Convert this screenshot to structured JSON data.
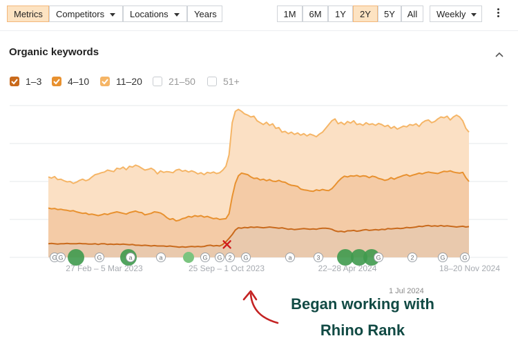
{
  "toolbar": {
    "tabs": [
      {
        "label": "Metrics",
        "active": true
      },
      {
        "label": "Competitors",
        "dropdown": true
      },
      {
        "label": "Locations",
        "dropdown": true
      },
      {
        "label": "Years"
      }
    ],
    "ranges": [
      "1M",
      "6M",
      "1Y",
      "2Y",
      "5Y",
      "All"
    ],
    "active_range": "2Y",
    "interval": "Weekly"
  },
  "section": {
    "title": "Organic keywords"
  },
  "legend": [
    {
      "label": "1–3",
      "checked": true,
      "color": "#c96a1c"
    },
    {
      "label": "4–10",
      "checked": true,
      "color": "#e8912f"
    },
    {
      "label": "11–20",
      "checked": true,
      "color": "#f5b566"
    },
    {
      "label": "21–50",
      "checked": false
    },
    {
      "label": "51+",
      "checked": false
    }
  ],
  "chart_data": {
    "type": "area",
    "stacked": true,
    "x_ticks": [
      "27 Feb – 5 Mar 2023",
      "25 Sep – 1 Oct 2023",
      "22–28 Apr 2024",
      "18–20 Nov 2024"
    ],
    "extra_date_label": "1 Jul 2024",
    "grid": true,
    "ylim": [
      0,
      4
    ],
    "series": [
      {
        "name": "1–3",
        "color": "#c96a1c",
        "fill": "#e9c9ad",
        "values": [
          0.36,
          0.37,
          0.36,
          0.35,
          0.36,
          0.36,
          0.37,
          0.36,
          0.36,
          0.36,
          0.37,
          0.36,
          0.36,
          0.35,
          0.35,
          0.36,
          0.34,
          0.36,
          0.36,
          0.34,
          0.35,
          0.34,
          0.35,
          0.34,
          0.35,
          0.34,
          0.33,
          0.34,
          0.32,
          0.32,
          0.31,
          0.32,
          0.31,
          0.3,
          0.31,
          0.3,
          0.3,
          0.3,
          0.29,
          0.3,
          0.29,
          0.28,
          0.27,
          0.28,
          0.27,
          0.28,
          0.29,
          0.28,
          0.29,
          0.28,
          0.29,
          0.31,
          0.32,
          0.3,
          0.31,
          0.3,
          0.34,
          0.41,
          0.5,
          0.6,
          0.72,
          0.78,
          0.77,
          0.79,
          0.78,
          0.8,
          0.79,
          0.8,
          0.79,
          0.78,
          0.79,
          0.8,
          0.79,
          0.78,
          0.77,
          0.78,
          0.76,
          0.74,
          0.75,
          0.73,
          0.74,
          0.75,
          0.76,
          0.75,
          0.74,
          0.75,
          0.74,
          0.76,
          0.77,
          0.77,
          0.76,
          0.74,
          0.7,
          0.68,
          0.69,
          0.67,
          0.7,
          0.7,
          0.71,
          0.69,
          0.7,
          0.72,
          0.73,
          0.71,
          0.72,
          0.73,
          0.72,
          0.74,
          0.73,
          0.76,
          0.75,
          0.76,
          0.77,
          0.76,
          0.77,
          0.79,
          0.78,
          0.79,
          0.8,
          0.82,
          0.81,
          0.83,
          0.84,
          0.82,
          0.83,
          0.82,
          0.84,
          0.82,
          0.83,
          0.82,
          0.81,
          0.8,
          0.81,
          0.82,
          0.8,
          0.81
        ]
      },
      {
        "name": "4–10",
        "color": "#e8912f",
        "fill": "#f4cba6",
        "values": [
          1.3,
          1.28,
          1.29,
          1.26,
          1.27,
          1.25,
          1.24,
          1.22,
          1.23,
          1.2,
          1.18,
          1.16,
          1.17,
          1.13,
          1.14,
          1.12,
          1.1,
          1.12,
          1.15,
          1.13,
          1.16,
          1.18,
          1.2,
          1.18,
          1.16,
          1.14,
          1.18,
          1.2,
          1.22,
          1.19,
          1.18,
          1.12,
          1.14,
          1.16,
          1.2,
          1.19,
          1.17,
          1.12,
          1.05,
          1.0,
          1.02,
          0.96,
          0.98,
          1.02,
          1.04,
          1.08,
          1.06,
          1.1,
          1.08,
          1.1,
          1.06,
          1.08,
          1.05,
          1.02,
          1.03,
          1.0,
          1.01,
          1.02,
          1.15,
          1.6,
          1.95,
          2.15,
          2.22,
          2.2,
          2.18,
          2.12,
          2.08,
          2.09,
          2.04,
          2.06,
          2.02,
          2.05,
          2.01,
          2.0,
          2.03,
          1.99,
          1.98,
          1.93,
          1.9,
          1.89,
          1.87,
          1.8,
          1.78,
          1.77,
          1.75,
          1.74,
          1.78,
          1.76,
          1.79,
          1.77,
          1.76,
          1.81,
          1.9,
          2.0,
          2.08,
          2.14,
          2.12,
          2.15,
          2.14,
          2.16,
          2.13,
          2.15,
          2.14,
          2.1,
          2.14,
          2.12,
          2.08,
          2.06,
          2.03,
          2.05,
          2.1,
          2.06,
          2.1,
          2.13,
          2.16,
          2.18,
          2.14,
          2.17,
          2.19,
          2.22,
          2.2,
          2.23,
          2.25,
          2.23,
          2.22,
          2.21,
          2.24,
          2.27,
          2.26,
          2.28,
          2.25,
          2.23,
          2.22,
          2.24,
          2.1,
          2.0
        ]
      },
      {
        "name": "11–20",
        "color": "#f5b566",
        "fill": "#fbe0c4",
        "values": [
          2.12,
          2.09,
          2.13,
          2.05,
          2.06,
          2.02,
          1.99,
          2.0,
          1.95,
          1.98,
          2.03,
          2.06,
          2.02,
          2.05,
          2.12,
          2.18,
          2.2,
          2.23,
          2.25,
          2.3,
          2.28,
          2.26,
          2.35,
          2.33,
          2.38,
          2.31,
          2.4,
          2.38,
          2.43,
          2.4,
          2.35,
          2.3,
          2.32,
          2.35,
          2.3,
          2.2,
          2.28,
          2.24,
          2.26,
          2.25,
          2.23,
          2.3,
          2.32,
          2.27,
          2.29,
          2.25,
          2.28,
          2.25,
          2.2,
          2.23,
          2.18,
          2.24,
          2.22,
          2.25,
          2.21,
          2.23,
          2.3,
          2.4,
          2.7,
          3.55,
          3.85,
          3.9,
          3.85,
          3.78,
          3.75,
          3.7,
          3.72,
          3.6,
          3.55,
          3.5,
          3.56,
          3.48,
          3.52,
          3.4,
          3.42,
          3.3,
          3.32,
          3.26,
          3.3,
          3.24,
          3.28,
          3.22,
          3.26,
          3.2,
          3.25,
          3.22,
          3.18,
          3.25,
          3.3,
          3.4,
          3.5,
          3.6,
          3.65,
          3.52,
          3.56,
          3.5,
          3.58,
          3.54,
          3.6,
          3.5,
          3.52,
          3.48,
          3.55,
          3.5,
          3.52,
          3.48,
          3.53,
          3.5,
          3.45,
          3.48,
          3.4,
          3.45,
          3.38,
          3.42,
          3.46,
          3.44,
          3.5,
          3.48,
          3.52,
          3.45,
          3.55,
          3.6,
          3.62,
          3.55,
          3.58,
          3.65,
          3.7,
          3.68,
          3.72,
          3.62,
          3.7,
          3.75,
          3.7,
          3.6,
          3.4,
          3.3
        ]
      }
    ],
    "marker": {
      "symbol": "x",
      "index": 56,
      "color": "#d01c1c"
    }
  },
  "timeline_events": [
    {
      "type": "G"
    },
    {
      "type": "G"
    },
    {
      "type": "dot-lg"
    },
    {
      "type": "G"
    },
    {
      "type": "dot-lg"
    },
    {
      "type": "a"
    },
    {
      "type": "a"
    },
    {
      "type": "dot-md"
    },
    {
      "type": "G"
    },
    {
      "type": "G"
    },
    {
      "type": "2"
    },
    {
      "type": "G"
    },
    {
      "type": "a"
    },
    {
      "type": "3"
    },
    {
      "type": "dot-lg"
    },
    {
      "type": "dot-lg"
    },
    {
      "type": "dot-lg"
    },
    {
      "type": "G"
    },
    {
      "type": "2"
    },
    {
      "type": "G"
    },
    {
      "type": "G"
    }
  ],
  "annotation": {
    "line1": "Began working with",
    "line2": "Rhino Rank"
  }
}
